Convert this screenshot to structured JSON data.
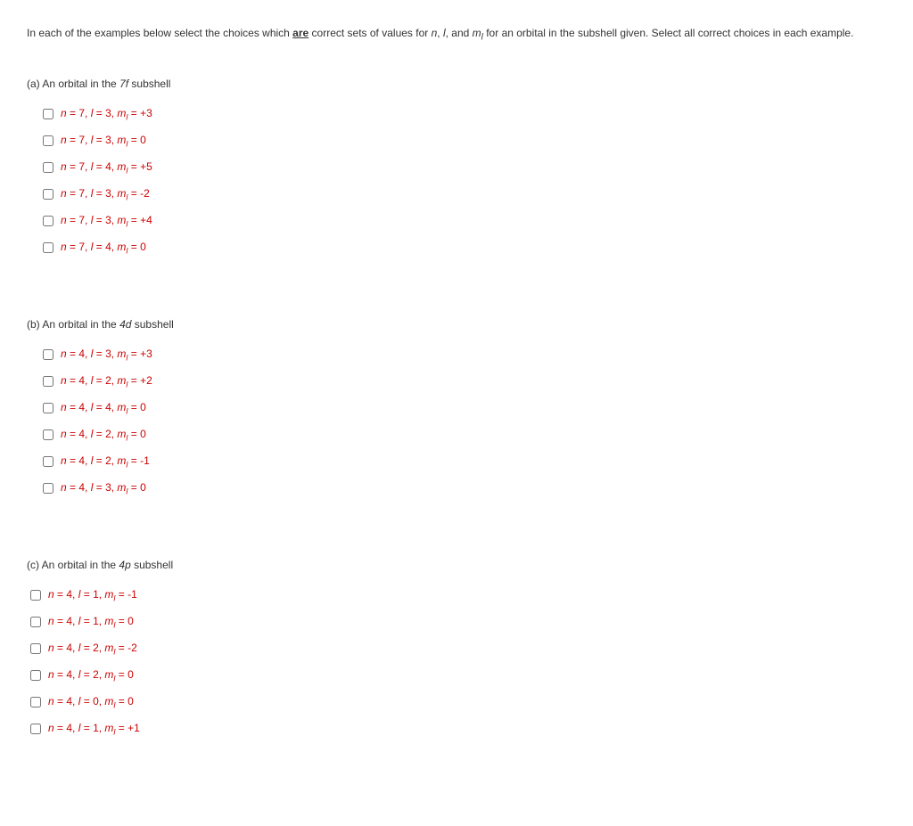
{
  "instruction": {
    "pre": "In each of the examples below select the choices which ",
    "are": "are",
    "mid": " correct sets of values for ",
    "n": "n",
    "comma1": ", ",
    "l": "l",
    "comma2": ", and ",
    "m": "m",
    "msub": "l",
    "post": " for an orbital in the subshell given. Select all correct choices in each example."
  },
  "sections": [
    {
      "label": "(a) An orbital in the ",
      "subshell": "7f",
      "label2": " subshell",
      "indent": true,
      "choices": [
        {
          "n": "7",
          "l": "3",
          "ml": "+3"
        },
        {
          "n": "7",
          "l": "3",
          "ml": "0"
        },
        {
          "n": "7",
          "l": "4",
          "ml": "+5"
        },
        {
          "n": "7",
          "l": "3",
          "ml": "-2"
        },
        {
          "n": "7",
          "l": "3",
          "ml": "+4"
        },
        {
          "n": "7",
          "l": "4",
          "ml": "0"
        }
      ]
    },
    {
      "label": "(b) An orbital in the ",
      "subshell": "4d",
      "label2": " subshell",
      "indent": true,
      "choices": [
        {
          "n": "4",
          "l": "3",
          "ml": "+3"
        },
        {
          "n": "4",
          "l": "2",
          "ml": "+2"
        },
        {
          "n": "4",
          "l": "4",
          "ml": "0"
        },
        {
          "n": "4",
          "l": "2",
          "ml": "0"
        },
        {
          "n": "4",
          "l": "2",
          "ml": "-1"
        },
        {
          "n": "4",
          "l": "3",
          "ml": "0"
        }
      ]
    },
    {
      "label": "(c) An orbital in the ",
      "subshell": "4p",
      "label2": " subshell",
      "indent": false,
      "choices": [
        {
          "n": "4",
          "l": "1",
          "ml": "-1"
        },
        {
          "n": "4",
          "l": "1",
          "ml": "0"
        },
        {
          "n": "4",
          "l": "2",
          "ml": "-2"
        },
        {
          "n": "4",
          "l": "2",
          "ml": "0"
        },
        {
          "n": "4",
          "l": "0",
          "ml": "0"
        },
        {
          "n": "4",
          "l": "1",
          "ml": "+1"
        }
      ]
    }
  ]
}
